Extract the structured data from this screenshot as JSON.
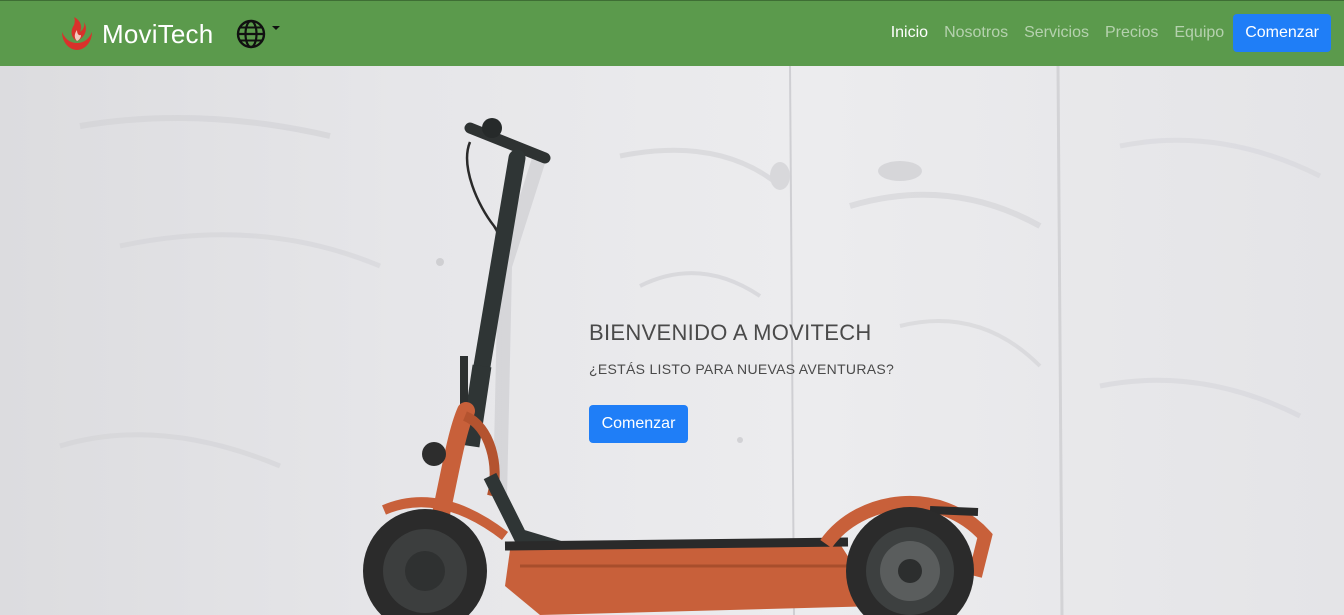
{
  "navbar": {
    "brand": "MoviTech",
    "links": [
      {
        "label": "Inicio",
        "active": true
      },
      {
        "label": "Nosotros",
        "active": false
      },
      {
        "label": "Servicios",
        "active": false
      },
      {
        "label": "Precios",
        "active": false
      },
      {
        "label": "Equipo",
        "active": false
      }
    ],
    "cta_label": "Comenzar",
    "language_icon": "globe-icon",
    "logo_icon": "flame-logo-icon"
  },
  "hero": {
    "title": "BIENVENIDO A MOVITECH",
    "subtitle": "¿ESTÁS LISTO PARA NUEVAS AVENTURAS?",
    "cta_label": "Comenzar",
    "background_image": "electric-scooter-against-concrete-wall"
  },
  "colors": {
    "navbar_bg": "#5b9a4c",
    "primary_button": "#1f7ef7",
    "logo_red": "#d9312b",
    "scooter_orange": "#c8603a"
  }
}
